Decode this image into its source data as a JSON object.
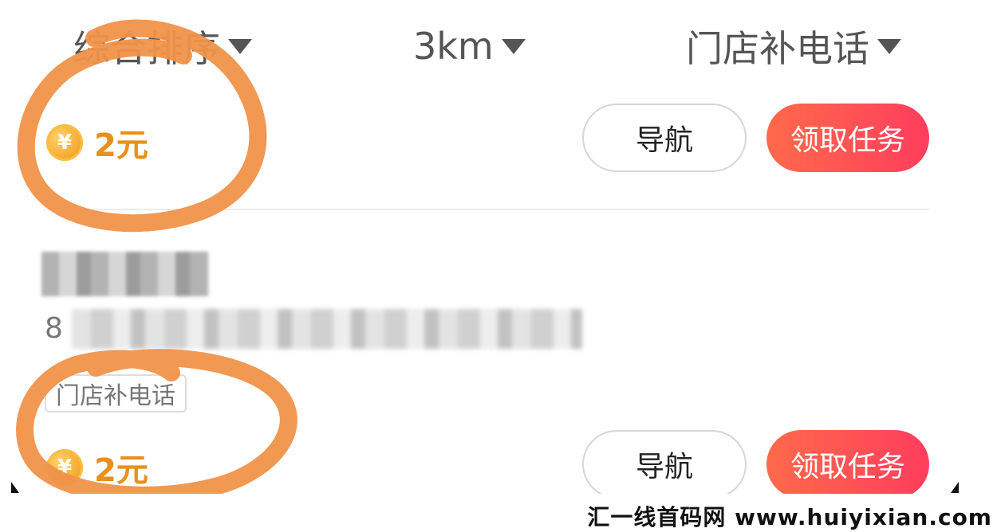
{
  "filters": [
    {
      "label": "综合排序"
    },
    {
      "label": "3km"
    },
    {
      "label": "门店补电话"
    }
  ],
  "tasks": [
    {
      "reward": {
        "coin_symbol": "¥",
        "amount": "2元"
      },
      "nav_label": "导航",
      "claim_label": "领取任务"
    },
    {
      "title_redacted": true,
      "distance_prefix": "8",
      "tag": "门店补电话",
      "reward": {
        "coin_symbol": "¥",
        "amount": "2元"
      },
      "nav_label": "导航",
      "claim_label": "领取任务"
    }
  ],
  "annotation_color": "#f0924a",
  "accent_color": "#ff4a57",
  "watermark": "汇一线首码网 www.huiyixian.com"
}
